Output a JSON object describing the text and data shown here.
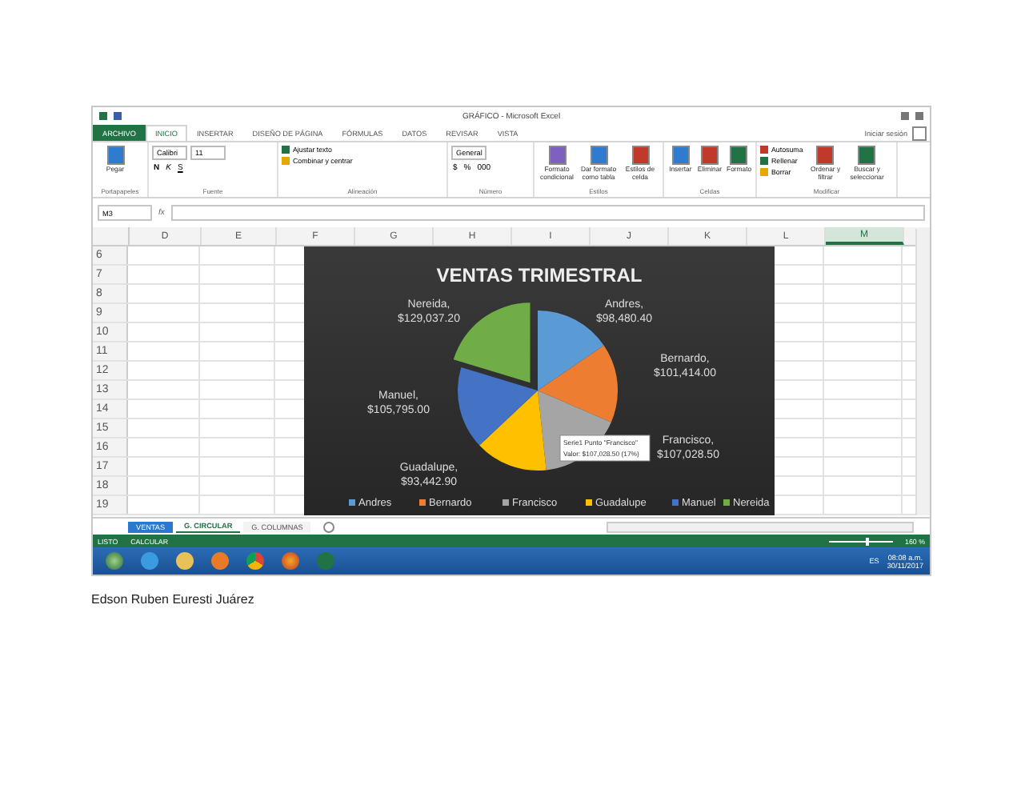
{
  "window": {
    "title": "GRÁFICO - Microsoft Excel",
    "account": "Iniciar sesión"
  },
  "ribbon_tabs": [
    {
      "label": "ARCHIVO",
      "kind": "file",
      "selected": false
    },
    {
      "label": "INICIO",
      "kind": "tab",
      "selected": true
    },
    {
      "label": "INSERTAR",
      "kind": "tab",
      "selected": false
    },
    {
      "label": "DISEÑO DE PÁGINA",
      "kind": "tab",
      "selected": false
    },
    {
      "label": "FÓRMULAS",
      "kind": "tab",
      "selected": false
    },
    {
      "label": "DATOS",
      "kind": "tab",
      "selected": false
    },
    {
      "label": "REVISAR",
      "kind": "tab",
      "selected": false
    },
    {
      "label": "VISTA",
      "kind": "tab",
      "selected": false
    }
  ],
  "ribbon_groups": [
    {
      "label": "Portapapeles",
      "buttons": [
        "Pegar"
      ]
    },
    {
      "label": "Fuente",
      "stack": [
        [
          {
            "kind": "field",
            "text": "Calibri"
          },
          {
            "kind": "field",
            "text": "11"
          }
        ],
        [
          {
            "kind": "bold",
            "text": "N"
          },
          {
            "kind": "italic",
            "text": "K"
          },
          {
            "kind": "underline",
            "text": "S"
          }
        ]
      ]
    },
    {
      "label": "Alineación",
      "stack": [
        [
          {
            "kind": "command",
            "text": "Ajustar texto"
          }
        ],
        [
          {
            "kind": "command",
            "text": "Combinar y centrar"
          }
        ]
      ]
    },
    {
      "label": "Número",
      "stack": [
        [
          {
            "kind": "field",
            "text": "General"
          }
        ],
        [
          {
            "kind": "glyph",
            "text": "$"
          },
          {
            "kind": "glyph",
            "text": "%"
          },
          {
            "kind": "glyph",
            "text": "000"
          }
        ]
      ]
    },
    {
      "label": "Estilos",
      "buttons": [
        "Formato condicional",
        "Dar formato como tabla",
        "Estilos de celda"
      ]
    },
    {
      "label": "Celdas",
      "buttons": [
        "Insertar",
        "Eliminar",
        "Formato"
      ]
    },
    {
      "label": "Modificar",
      "stack": [
        [
          {
            "kind": "command",
            "text": "Autosuma"
          }
        ],
        [
          {
            "kind": "command",
            "text": "Rellenar"
          }
        ],
        [
          {
            "kind": "command",
            "text": "Borrar"
          }
        ]
      ],
      "buttons": [
        "Ordenar y filtrar",
        "Buscar y seleccionar"
      ]
    }
  ],
  "formula_bar": {
    "name_box": "M3",
    "function_label": "fx"
  },
  "columns": [
    {
      "label": "D",
      "selected": false
    },
    {
      "label": "E",
      "selected": false
    },
    {
      "label": "F",
      "selected": false
    },
    {
      "label": "G",
      "selected": false
    },
    {
      "label": "H",
      "selected": false
    },
    {
      "label": "I",
      "selected": false
    },
    {
      "label": "J",
      "selected": false
    },
    {
      "label": "K",
      "selected": false
    },
    {
      "label": "L",
      "selected": false
    },
    {
      "label": "M",
      "selected": true
    }
  ],
  "rows": [
    "6",
    "7",
    "8",
    "9",
    "10",
    "11",
    "12",
    "13",
    "14",
    "15",
    "16",
    "17",
    "18",
    "19"
  ],
  "chart": {
    "chart_data": {
      "type": "pie",
      "title": "VENTAS TRIMESTRAL",
      "categories": [
        "Andres",
        "Bernardo",
        "Francisco",
        "Guadalupe",
        "Manuel",
        "Nereida"
      ],
      "values": [
        15.5,
        16.0,
        16.8,
        14.7,
        16.7,
        20.3
      ],
      "colors": [
        "#5b9bd5",
        "#ed7d31",
        "#a5a5a5",
        "#ffc000",
        "#4472c4",
        "#70ad47"
      ],
      "data_labels": true,
      "legend": true,
      "value_labels": [
        [
          "Andres,",
          "$98,480.40"
        ],
        [
          "Bernardo,",
          "$101,414.00"
        ],
        [
          "Francisco,",
          "$107,028.50"
        ],
        [
          "Guadalupe,",
          "$93,442.90"
        ],
        [
          "Manuel,",
          "$105,795.00"
        ],
        [
          "Nereida,",
          "$129,037.20"
        ]
      ]
    },
    "tooltip": [
      "Serie1 Punto \"Francisco\"",
      "Valor: $107,028.50 (17%)"
    ]
  },
  "sheet_tabs": [
    {
      "label": "VENTAS",
      "color": "#2b78d0",
      "selected": false
    },
    {
      "label": "G. CIRCULAR",
      "selected": true
    },
    {
      "label": "G. COLUMNAS",
      "selected": false
    }
  ],
  "status_bar": {
    "mode": "LISTO",
    "note": "CALCULAR",
    "zoom": "160 %",
    "zoom_slider": {
      "level": 0.58
    }
  },
  "taskbar": {
    "language": "ES",
    "time": "08:08 a.m.",
    "date": "30/11/2017"
  },
  "caption": "Edson Ruben Euresti Juárez"
}
